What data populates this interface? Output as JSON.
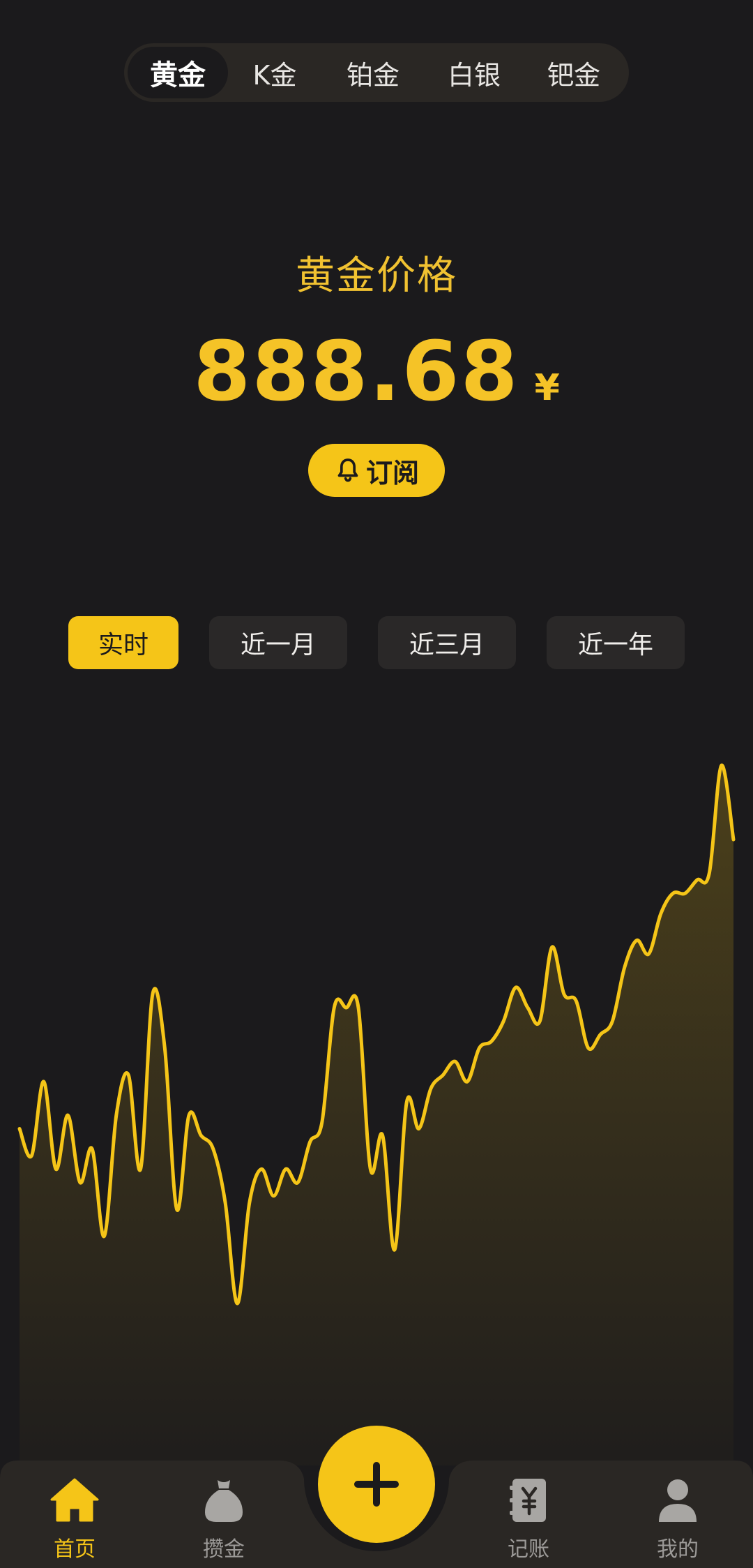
{
  "metal_tabs": [
    {
      "label": "黄金",
      "active": true
    },
    {
      "label": "K金",
      "active": false
    },
    {
      "label": "铂金",
      "active": false
    },
    {
      "label": "白银",
      "active": false
    },
    {
      "label": "钯金",
      "active": false
    }
  ],
  "price": {
    "label": "黄金价格",
    "value": "888.68",
    "currency": "¥"
  },
  "subscribe": {
    "label": "订阅",
    "icon": "bell-icon"
  },
  "range_tabs": [
    {
      "label": "实时",
      "active": true
    },
    {
      "label": "近一月",
      "active": false
    },
    {
      "label": "近三月",
      "active": false
    },
    {
      "label": "近一年",
      "active": false
    }
  ],
  "colors": {
    "accent": "#f5c518",
    "background": "#1b1a1c",
    "nav_background": "#2a2724",
    "inactive_text": "#9c9a98"
  },
  "chart_data": {
    "type": "area",
    "x": [
      0,
      1,
      2,
      3,
      4,
      5,
      6,
      7,
      8,
      9,
      10,
      11,
      12,
      13,
      14,
      15,
      16,
      17,
      18,
      19,
      20,
      21,
      22,
      23,
      24,
      25,
      26,
      27,
      28,
      29,
      30,
      31,
      32,
      33,
      34,
      35,
      36,
      37,
      38,
      39,
      40,
      41,
      42,
      43,
      44,
      45,
      46,
      47,
      48,
      49,
      50,
      51,
      52,
      53,
      54,
      55,
      56,
      57,
      58,
      59,
      60,
      61,
      62,
      63,
      64,
      65,
      66,
      67,
      68,
      69,
      70,
      71,
      72,
      73,
      74,
      75,
      76,
      77,
      78,
      79,
      80
    ],
    "series": [
      {
        "values": [
          48,
          44,
          55,
          42,
          50,
          40,
          45,
          32,
          50,
          56,
          42,
          68,
          60,
          36,
          50,
          47,
          45,
          37,
          22,
          37,
          42,
          38,
          42,
          40,
          46,
          49,
          66,
          66,
          66,
          42,
          47,
          30,
          52,
          48,
          54,
          56,
          58,
          55,
          60,
          61,
          64,
          69,
          66,
          64,
          75,
          68,
          67,
          60,
          62,
          64,
          72,
          76,
          74,
          80,
          83,
          83,
          85,
          86,
          102,
          91
        ]
      }
    ],
    "title": "",
    "xlabel": "",
    "ylabel": "",
    "ylim": [
      0,
      110
    ],
    "grid": false,
    "legend": "none"
  },
  "bottom_nav": {
    "items": [
      {
        "label": "首页",
        "icon": "home-icon",
        "active": true
      },
      {
        "label": "攒金",
        "icon": "money-bag-icon",
        "active": false
      },
      {
        "label": "记账",
        "icon": "ledger-icon",
        "active": false
      },
      {
        "label": "我的",
        "icon": "user-icon",
        "active": false
      }
    ],
    "fab_icon": "plus-icon"
  }
}
